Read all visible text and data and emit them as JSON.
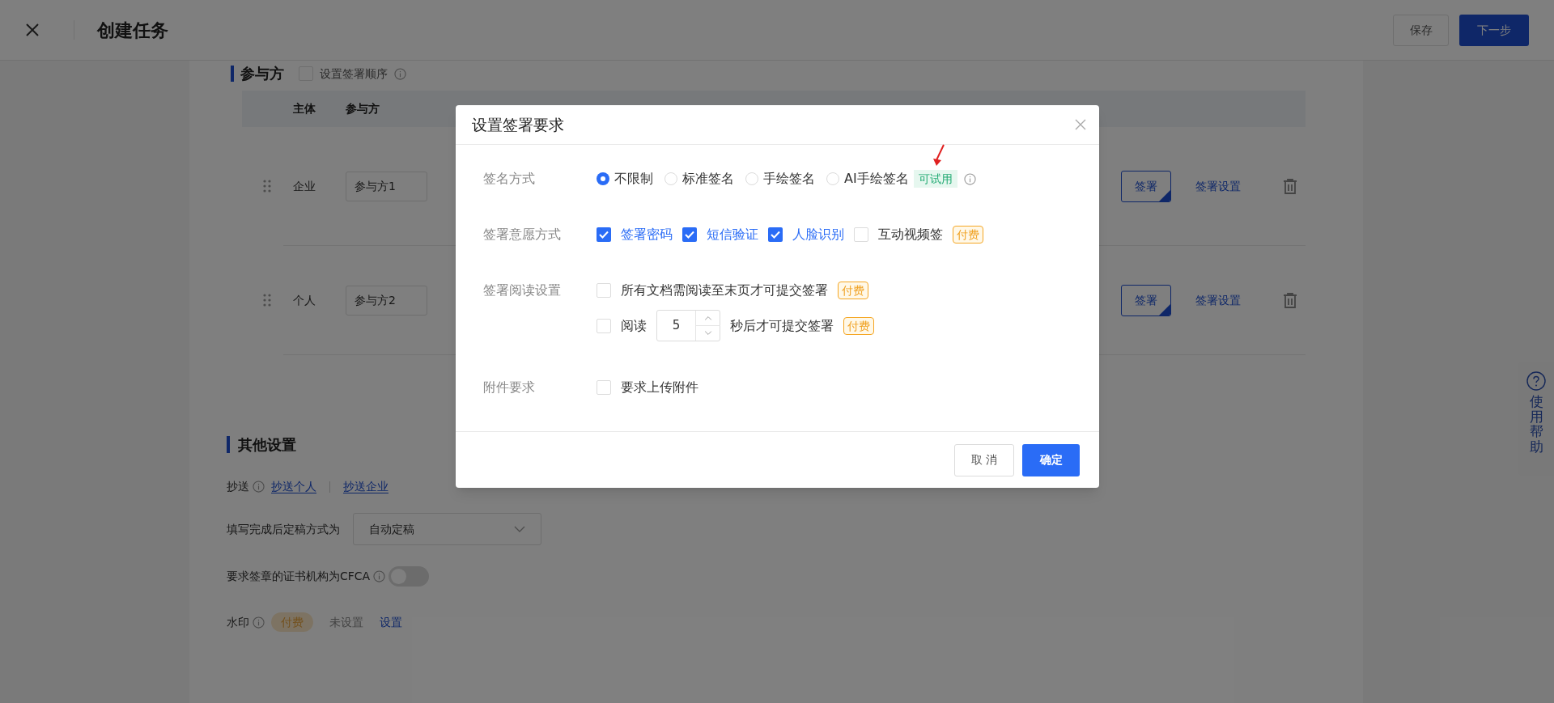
{
  "header": {
    "title": "创建任务",
    "buttons": [
      {
        "label": "保存",
        "kind": "default"
      },
      {
        "label": "下一步",
        "kind": "dark"
      }
    ]
  },
  "participants": {
    "title": "参与方",
    "order_option": {
      "label": "设置签署顺序",
      "checked": false
    },
    "columns": [
      {
        "label": "主体"
      },
      {
        "label": "参与方"
      }
    ],
    "rows": [
      {
        "subject": "企业",
        "name": "参与方1",
        "sign_button": "签署",
        "settings_link": "签署设置"
      },
      {
        "subject": "个人",
        "name": "参与方2",
        "sign_button": "签署",
        "settings_link": "签署设置"
      }
    ]
  },
  "other_settings": {
    "title": "其他设置",
    "cc": {
      "label": "抄送",
      "links": [
        "抄送个人",
        "抄送企业"
      ]
    },
    "finalize": {
      "label": "填写完成后定稿方式为",
      "value": "自动定稿"
    },
    "cfca": {
      "label": "要求签章的证书机构为CFCA",
      "on": false
    },
    "watermark": {
      "label": "水印",
      "tag": "付费",
      "status": "未设置",
      "link": "设置"
    }
  },
  "help": {
    "label": "使用帮助"
  },
  "dialog": {
    "title": "设置签署要求",
    "rows": [
      {
        "label": "签名方式",
        "kind": "radio",
        "options": [
          {
            "label": "不限制",
            "selected": true
          },
          {
            "label": "标准签名",
            "selected": false
          },
          {
            "label": "手绘签名",
            "selected": false
          },
          {
            "label": "AI手绘签名",
            "selected": false,
            "tag": {
              "label": "可试用",
              "kind": "trial"
            },
            "info": true
          }
        ]
      },
      {
        "label": "签署意愿方式",
        "kind": "checkbox",
        "options": [
          {
            "label": "签署密码",
            "checked": true
          },
          {
            "label": "短信验证",
            "checked": true
          },
          {
            "label": "人脸识别",
            "checked": true
          },
          {
            "label": "互动视频签",
            "checked": false,
            "tag": {
              "label": "付费",
              "kind": "paid"
            }
          }
        ]
      },
      {
        "label": "签署阅读设置",
        "kind": "list",
        "items": [
          {
            "kind": "text",
            "label": "所有文档需阅读至末页才可提交签署",
            "checked": false,
            "tag": {
              "label": "付费",
              "kind": "paid"
            }
          },
          {
            "kind": "timer",
            "prefix": "阅读",
            "value": "5",
            "suffix": "秒后才可提交签署",
            "checked": false,
            "tag": {
              "label": "付费",
              "kind": "paid"
            }
          }
        ]
      },
      {
        "label": "附件要求",
        "kind": "checkbox",
        "options": [
          {
            "label": "要求上传附件",
            "checked": false
          }
        ]
      }
    ],
    "buttons": [
      {
        "label": "取 消",
        "kind": "default"
      },
      {
        "label": "确定",
        "kind": "primary"
      }
    ]
  }
}
